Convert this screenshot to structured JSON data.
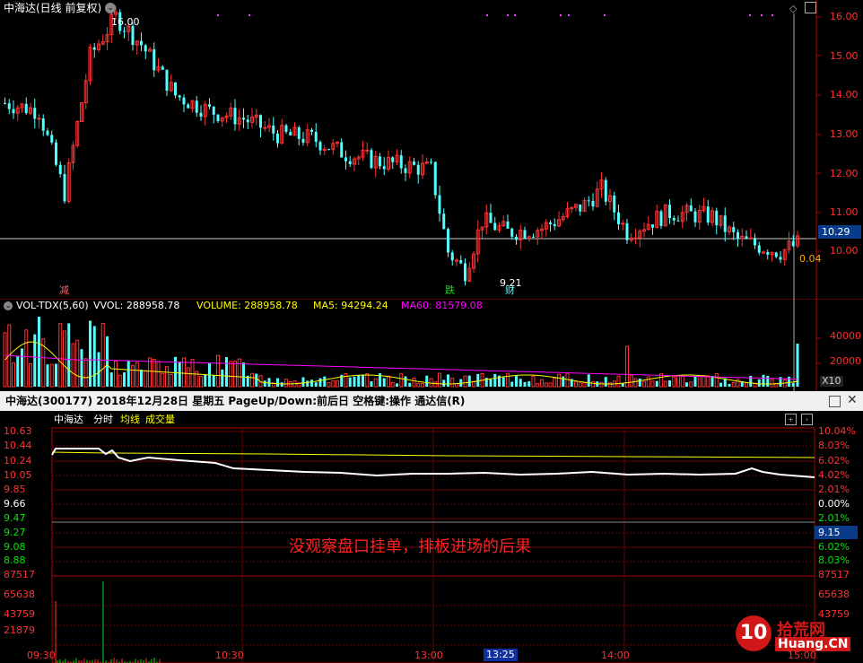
{
  "kline": {
    "title": "中海达(日线 前复权)",
    "high_mark": "16.00",
    "low_mark": "9.21",
    "current_price": "10.29",
    "price_change": "0.04",
    "y_ticks": [
      "16.00",
      "15.00",
      "14.00",
      "13.00",
      "12.00",
      "11.00",
      "10.00"
    ],
    "signals": {
      "left": "减",
      "mid": "跌",
      "mid2": "财"
    }
  },
  "vol": {
    "label_name": "VOL-TDX(5,60)",
    "vvol": "VVOL: 288958.78",
    "volume": "VOLUME: 288958.78",
    "ma5": "MA5: 94294.24",
    "ma60": "MA60: 81579.08",
    "y_ticks": [
      "40000",
      "20000"
    ],
    "unit": "X10"
  },
  "intraday": {
    "header": "中海达(300177)  2018年12月28日 星期五  PageUp/Down:前后日  空格键:操作  通达信(R)",
    "stock_name": "中海达",
    "tab_time": "分时",
    "tab_avg": "均线",
    "tab_vol": "成交量",
    "left_prices": [
      "10.63",
      "10.44",
      "10.24",
      "10.05",
      "9.85",
      "9.66",
      "9.47",
      "9.27",
      "9.08",
      "8.88"
    ],
    "right_pcts": [
      "10.04%",
      "8.03%",
      "6.02%",
      "4.02%",
      "2.01%",
      "0.00%",
      "2.01%",
      "4.02%",
      "6.02%",
      "8.03%"
    ],
    "vol_left": [
      "87517",
      "65638",
      "43759",
      "21879"
    ],
    "vol_right": [
      "87517",
      "65638",
      "43759"
    ],
    "current_price_box": "9.15",
    "annotation": "没观察盘口挂单，排板进场的后果",
    "time_axis": [
      "09:30",
      "10:30",
      "13:00",
      "13:25",
      "14:00",
      "15:00"
    ]
  },
  "watermark": {
    "number": "10",
    "text1": "拾荒网",
    "text2": "Huang.CN"
  }
}
